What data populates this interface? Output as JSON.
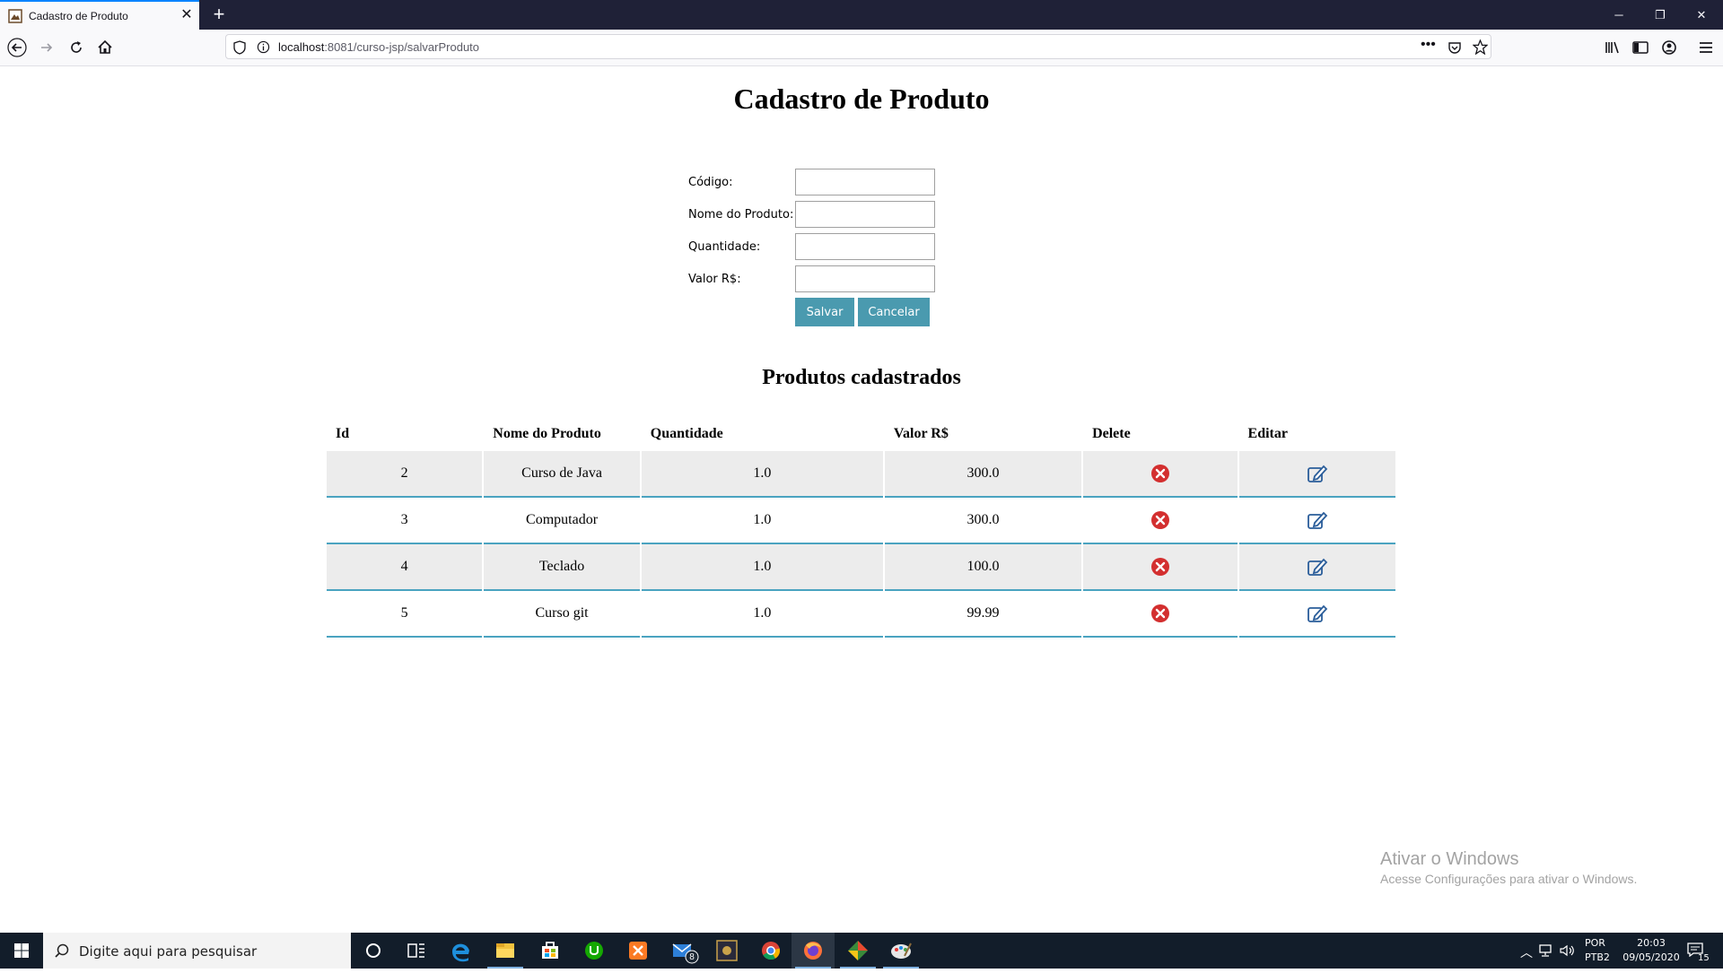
{
  "browser": {
    "tab_title": "Cadastro de Produto",
    "url_host": "localhost",
    "url_rest": ":8081/curso-jsp/salvarProduto"
  },
  "page": {
    "title": "Cadastro de Produto",
    "form": {
      "labels": {
        "codigo": "Código:",
        "nome": "Nome do Produto:",
        "quantidade": "Quantidade:",
        "valor": "Valor R$:"
      },
      "values": {
        "codigo": "",
        "nome": "",
        "quantidade": "",
        "valor": ""
      },
      "save_label": "Salvar",
      "cancel_label": "Cancelar"
    },
    "list_title": "Produtos cadastrados",
    "table": {
      "headers": [
        "Id",
        "Nome do Produto",
        "Quantidade",
        "Valor R$",
        "Delete",
        "Editar"
      ],
      "rows": [
        {
          "id": "2",
          "nome": "Curso de Java",
          "quantidade": "1.0",
          "valor": "300.0"
        },
        {
          "id": "3",
          "nome": "Computador",
          "quantidade": "1.0",
          "valor": "300.0"
        },
        {
          "id": "4",
          "nome": "Teclado",
          "quantidade": "1.0",
          "valor": "100.0"
        },
        {
          "id": "5",
          "nome": "Curso git",
          "quantidade": "1.0",
          "valor": "99.99"
        }
      ]
    },
    "watermark": {
      "line1": "Ativar o Windows",
      "line2": "Acesse Configurações para ativar o Windows."
    }
  },
  "taskbar": {
    "search_placeholder": "Digite aqui para pesquisar",
    "mail_badge": "8",
    "lang_top": "POR",
    "lang_bottom": "PTB2",
    "time": "20:03",
    "date": "09/05/2020",
    "notifications": "15"
  },
  "colors": {
    "button": "#4a9aaf",
    "row_border": "#4aa3c0",
    "row_alt": "#ececec",
    "delete_icon": "#d32f2f",
    "edit_icon": "#2a5d9a"
  }
}
